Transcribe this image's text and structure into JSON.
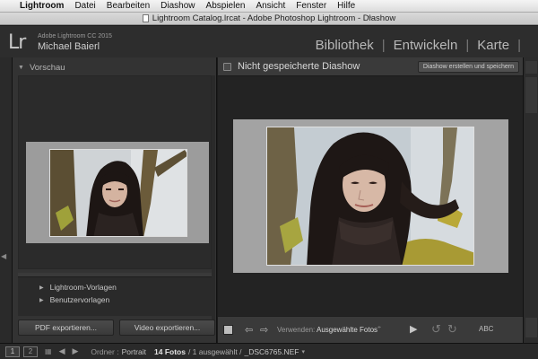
{
  "menubar": {
    "app_name": "Lightroom",
    "items": [
      "Datei",
      "Bearbeiten",
      "Diashow",
      "Abspielen",
      "Ansicht",
      "Fenster",
      "Hilfe"
    ]
  },
  "window": {
    "title": "Lightroom Catalog.lrcat - Adobe Photoshop Lightroom - Diashow"
  },
  "identity": {
    "logo": "Lr",
    "product": "Adobe Lightroom CC 2015",
    "user": "Michael Baierl"
  },
  "modules": [
    "Bibliothek",
    "Entwickeln",
    "Karte"
  ],
  "left_panel": {
    "preview_header": "Vorschau",
    "template_items": [
      "Lightroom-Vorlagen",
      "Benutzervorlagen"
    ],
    "pdf_button": "PDF exportieren...",
    "video_button": "Video exportieren..."
  },
  "center": {
    "title": "Nicht gespeicherte Diashow",
    "create_button": "Diashow erstellen und speichern"
  },
  "toolbar": {
    "use_label": "Verwenden:",
    "use_value": "Ausgewählte Fotos",
    "caret": "÷",
    "text_button": "ABC"
  },
  "filmstrip": {
    "monitor1": "1",
    "monitor2": "2",
    "source_label": "Ordner :",
    "source_value": "Portrait",
    "count": "14 Fotos",
    "count_rest": "/ 1 ausgewählt /",
    "filename": "_DSC6765.NEF",
    "caret": "▾"
  },
  "colors": {
    "panel_bg": "#333333",
    "stage_bg": "#232323",
    "slide_bg": "#a3a3a3",
    "module_text": "#b8b8b8"
  },
  "icons": {
    "apple": "apple-logo-icon",
    "stop": "stop-icon",
    "prev": "arrow-left-icon",
    "next": "arrow-right-icon",
    "play": "play-icon",
    "rotate_left": "rotate-left-icon",
    "rotate_right": "rotate-right-icon"
  }
}
